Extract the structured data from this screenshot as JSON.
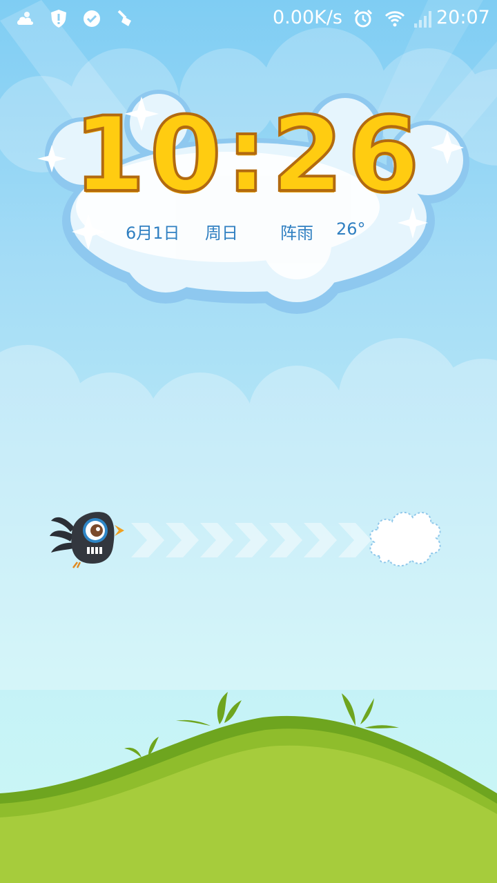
{
  "status_bar": {
    "network_speed": "0.00K/s",
    "time": "20:07",
    "icons": [
      "weather-cloud-icon",
      "shield-alert-icon",
      "check-circle-icon",
      "broom-icon",
      "alarm-clock-icon",
      "wifi-icon",
      "signal-icon"
    ]
  },
  "lockscreen": {
    "clock": "10:26",
    "date": "6月1日",
    "weekday": "周日",
    "weather": "阵雨",
    "temperature": "26°"
  },
  "unlock": {
    "bird_icon": "black-bird-icon",
    "arrows_icon": "chevron-right-icon",
    "target_icon": "cloud-target-icon"
  },
  "colors": {
    "clock_fill": "#ffcc11",
    "clock_outline": "#b26a10",
    "info_text": "#2f7fc1",
    "hill_green": "#a6cc3c",
    "sky_top": "#7fcdf3",
    "sky_bottom": "#cdf8f5"
  }
}
